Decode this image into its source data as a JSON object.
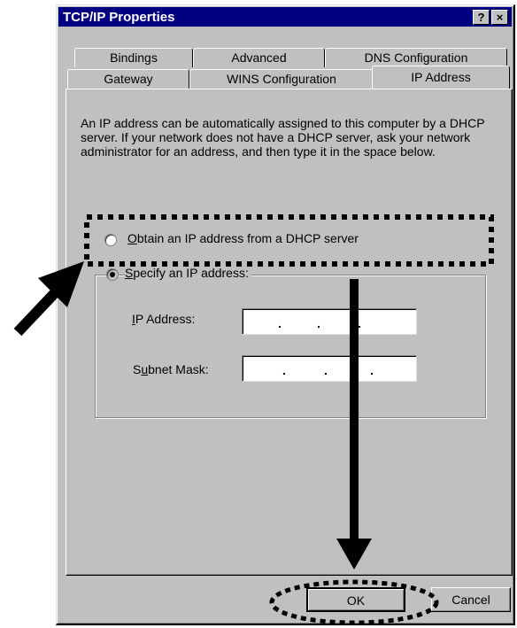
{
  "window": {
    "title": "TCP/IP Properties",
    "help_label": "?",
    "close_label": "×"
  },
  "tabs": {
    "back_row": [
      "Bindings",
      "Advanced",
      "DNS Configuration"
    ],
    "front_row": [
      "Gateway",
      "WINS Configuration",
      "IP Address"
    ],
    "active": "IP Address"
  },
  "description": "An IP address can be automatically assigned to this computer by a DHCP server. If your network does not have a DHCP server, ask your network administrator for an address, and then type it in the space below.",
  "options": {
    "dhcp": {
      "access_key": "O",
      "rest": "btain an IP address from a DHCP server",
      "selected": false
    },
    "specify": {
      "access_key": "S",
      "rest": "pecify an IP address:",
      "selected": true
    }
  },
  "fields": {
    "ip_address": {
      "label_pre": "",
      "access_key": "I",
      "label_post": "P Address:",
      "value": ""
    },
    "subnet_mask": {
      "label_pre": "S",
      "access_key": "u",
      "label_post": "bnet Mask:",
      "value": ""
    }
  },
  "buttons": {
    "ok": "OK",
    "cancel": "Cancel"
  },
  "annotation_colors": {
    "highlight": "#000000"
  }
}
